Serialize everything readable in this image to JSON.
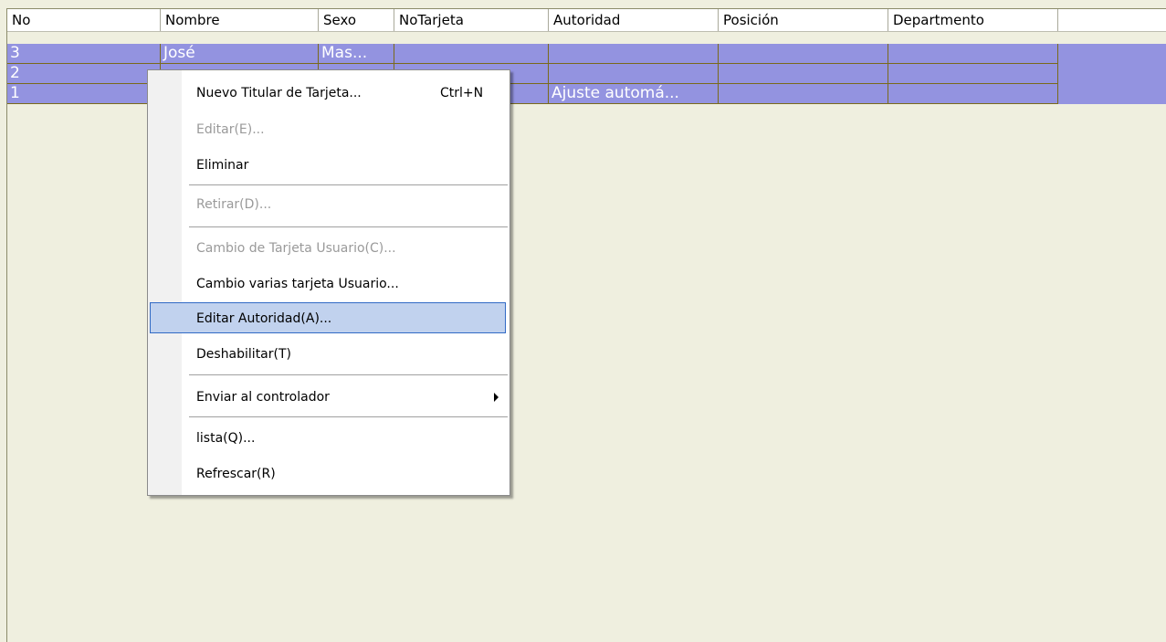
{
  "table": {
    "columns": [
      "No",
      "Nombre",
      "Sexo",
      "NoTarjeta",
      "Autoridad",
      "Posición",
      "Departmento"
    ],
    "rows": [
      {
        "no": "3",
        "nombre": "José",
        "sexo": "Mas...",
        "notarjeta": "",
        "autoridad": "",
        "posicion": "",
        "departamento": ""
      },
      {
        "no": "2",
        "nombre": "",
        "sexo": "",
        "notarjeta": "",
        "autoridad": "",
        "posicion": "",
        "departamento": ""
      },
      {
        "no": "1",
        "nombre": "",
        "sexo": "",
        "notarjeta": "",
        "autoridad": "Ajuste automá...",
        "posicion": "",
        "departamento": ""
      }
    ],
    "row_color": "#9393e0"
  },
  "context_menu": {
    "items": [
      {
        "label": "Nuevo Titular de Tarjeta...",
        "shortcut": "Ctrl+N",
        "enabled": true
      },
      {
        "label": "Editar(E)...",
        "enabled": false
      },
      {
        "label": "Eliminar",
        "enabled": true
      },
      {
        "label": "Retirar(D)...",
        "enabled": false
      },
      {
        "label": "Cambio de Tarjeta Usuario(C)...",
        "enabled": false
      },
      {
        "label": "Cambio varias tarjeta Usuario...",
        "enabled": true
      },
      {
        "label": "Editar Autoridad(A)...",
        "enabled": true,
        "highlighted": true
      },
      {
        "label": "Deshabilitar(T)",
        "enabled": true
      },
      {
        "label": "Enviar al controlador",
        "enabled": true,
        "submenu": true
      },
      {
        "label": "lista(Q)...",
        "enabled": true
      },
      {
        "label": "Refrescar(R)",
        "enabled": true
      }
    ],
    "highlight_color": "#c1d2ee"
  }
}
